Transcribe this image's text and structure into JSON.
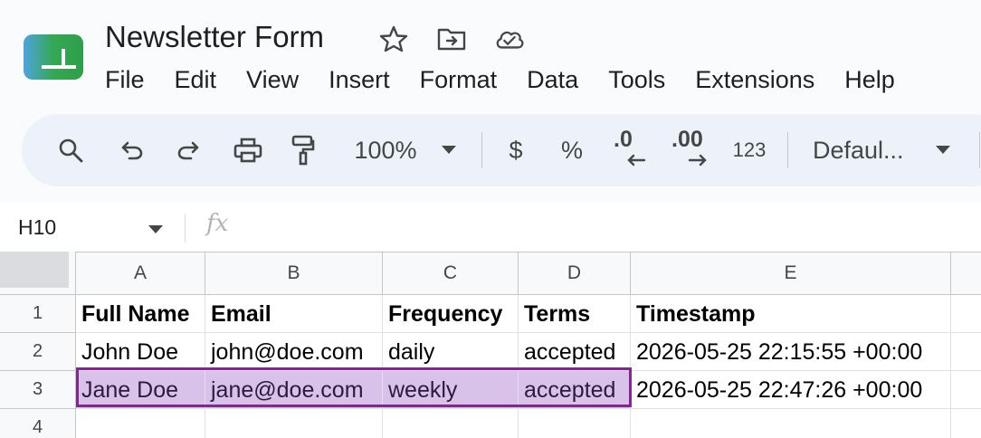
{
  "app": {
    "doc_title": "Newsletter Form",
    "brand_color": "#34a853",
    "title_icons": [
      "star-icon",
      "move-to-folder-icon",
      "cloud-saved-icon"
    ]
  },
  "menu": {
    "items": [
      "File",
      "Edit",
      "View",
      "Insert",
      "Format",
      "Data",
      "Tools",
      "Extensions",
      "Help"
    ]
  },
  "toolbar": {
    "zoom": "100%",
    "currency": "$",
    "percent": "%",
    "decrease_decimals": ".0",
    "increase_decimals": ".00",
    "number_format": "123",
    "font": "Defaul..."
  },
  "formula_bar": {
    "name_box": "H10",
    "fx_label": "fx"
  },
  "sheet": {
    "columns": [
      "A",
      "B",
      "C",
      "D",
      "E"
    ],
    "rows": [
      "1",
      "2",
      "3",
      "4"
    ],
    "cells": [
      [
        "Full Name",
        "Email",
        "Frequency",
        "Terms",
        "Timestamp"
      ],
      [
        "John Doe",
        "john@doe.com",
        "daily",
        "accepted",
        "2026-05-25 22:15:55 +00:00"
      ],
      [
        "Jane Doe",
        "jane@doe.com",
        "weekly",
        "accepted",
        "2026-05-25 22:47:26 +00:00"
      ],
      [
        "",
        "",
        "",
        "",
        ""
      ]
    ],
    "selection_color": "#d9c2ea",
    "selection_border_color": "#7d2a8c"
  }
}
